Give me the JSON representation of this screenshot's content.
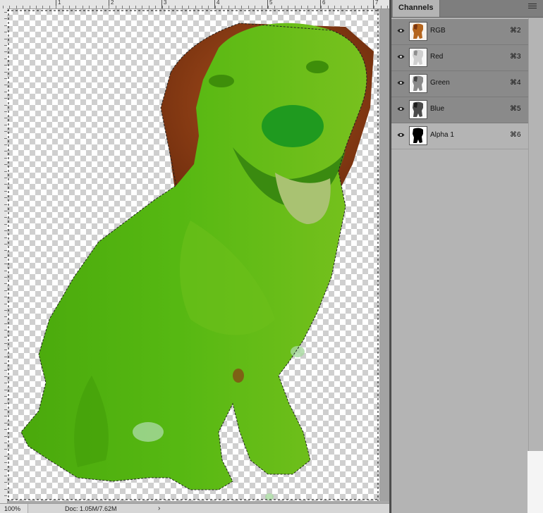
{
  "ruler": {
    "labels": [
      "1",
      "2",
      "3",
      "4",
      "5",
      "6",
      "7"
    ]
  },
  "status": {
    "zoom": "100%",
    "doc": "Doc: 1.05M/7.62M",
    "arrow": "›"
  },
  "panel": {
    "tab": "Channels",
    "channels": [
      {
        "label": "RGB",
        "shortcut": "⌘2",
        "active": true,
        "thumb": "color"
      },
      {
        "label": "Red",
        "shortcut": "⌘3",
        "active": true,
        "thumb": "light"
      },
      {
        "label": "Green",
        "shortcut": "⌘4",
        "active": true,
        "thumb": "mid"
      },
      {
        "label": "Blue",
        "shortcut": "⌘5",
        "active": true,
        "thumb": "dark"
      },
      {
        "label": "Alpha 1",
        "shortcut": "⌘6",
        "active": false,
        "thumb": "mask"
      }
    ]
  },
  "colors": {
    "overlay_green": "#4fb80f",
    "fur_brown": "#8a3a14",
    "panel_bg": "#b4b4b4",
    "panel_selected": "#8a8a8a"
  },
  "icons": {
    "visibility": "eye-icon",
    "panel_menu": "hamburger-menu-icon"
  }
}
